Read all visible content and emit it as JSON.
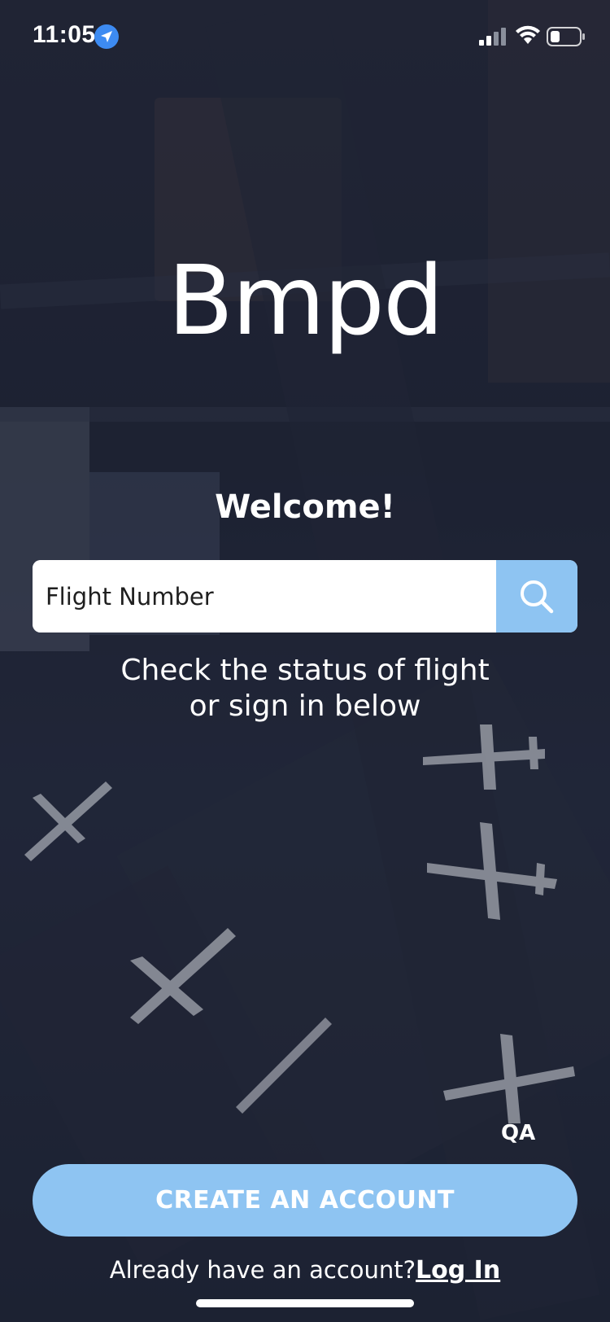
{
  "status_bar": {
    "time": "11:05",
    "icons": [
      "location-arrow-icon",
      "cellular-signal-icon",
      "wifi-icon",
      "battery-icon"
    ]
  },
  "brand": {
    "logo_text": "Bmpd"
  },
  "main": {
    "welcome": "Welcome!",
    "search": {
      "placeholder": "Flight Number",
      "value": "",
      "icon": "search-icon"
    },
    "subtext_line1": "Check the status of flight",
    "subtext_line2": "or sign in below"
  },
  "footer": {
    "env_badge": "QA",
    "create_account_label": "CREATE AN ACCOUNT",
    "login_prompt": "Already have an account?",
    "login_link": "Log In"
  },
  "colors": {
    "accent": "#8ec4f2",
    "location_blue": "#3d8bf2",
    "background_dark": "#252a3b",
    "text": "#ffffff"
  }
}
